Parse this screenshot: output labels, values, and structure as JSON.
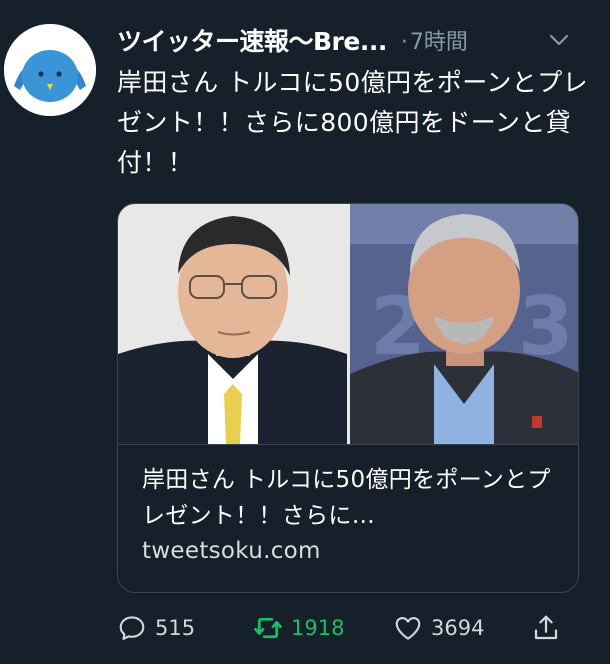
{
  "author": {
    "name": "ツイッター速報〜Bre...",
    "avatar_icon": "bird-mascot-icon"
  },
  "meta": {
    "separator": "·",
    "time": "7時間"
  },
  "tweet": {
    "text": "岸田さん トルコに50億円をポーンとプレゼント！！さらに800億円をドーンと貸付！！"
  },
  "card": {
    "title": "岸田さん トルコに50億円をポーンとプレゼント！！さらに…",
    "domain": "tweetsoku.com"
  },
  "actions": {
    "reply_count": "515",
    "retweet_count": "1918",
    "like_count": "3694",
    "retweet_color": "#17bf63"
  },
  "colors": {
    "background": "#15202b",
    "muted": "#8899a6",
    "border": "#38444d"
  }
}
